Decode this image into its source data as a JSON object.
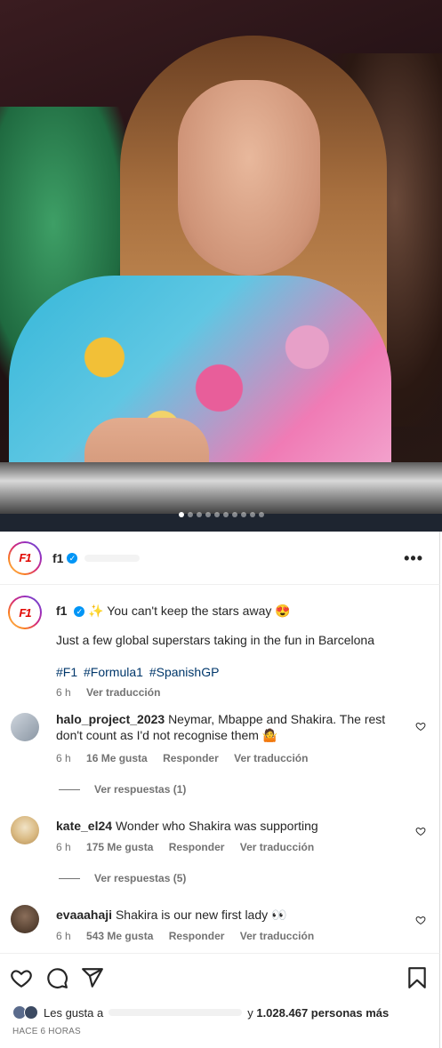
{
  "carousel": {
    "total_slides": 10,
    "active_index": 0
  },
  "header": {
    "username": "f1",
    "more_icon": "more-horizontal-icon"
  },
  "caption": {
    "username": "f1",
    "text": "✨ You can't keep the stars away 😍",
    "line2": "Just a few global superstars taking in the fun in Barcelona",
    "hashtags": [
      "#F1",
      "#Formula1",
      "#SpanishGP"
    ],
    "time": "6 h",
    "translate": "Ver traducción"
  },
  "comments": [
    {
      "username": "halo_project_2023",
      "text": "Neymar, Mbappe and Shakira. The rest don't count as I'd not recognise them 🤷",
      "time": "6 h",
      "likes": "16 Me gusta",
      "reply": "Responder",
      "translate": "Ver traducción",
      "view_replies": "Ver respuestas (1)"
    },
    {
      "username": "kate_el24",
      "text": "Wonder who Shakira was supporting",
      "time": "6 h",
      "likes": "175 Me gusta",
      "reply": "Responder",
      "translate": "Ver traducción",
      "view_replies": "Ver respuestas (5)"
    },
    {
      "username": "evaaahaji",
      "text": "Shakira is our new first lady 👀",
      "time": "6 h",
      "likes": "543 Me gusta",
      "reply": "Responder",
      "translate": "Ver traducción",
      "view_replies": ""
    }
  ],
  "likes": {
    "prefix": "Les gusta a",
    "connector": "y",
    "count": "1.028.467 personas más"
  },
  "timestamp": "HACE 6 HORAS",
  "colors": {
    "accent_blue": "#0095f6",
    "hashtag": "#00376b",
    "f1_red": "#e10600",
    "muted": "#737373"
  }
}
